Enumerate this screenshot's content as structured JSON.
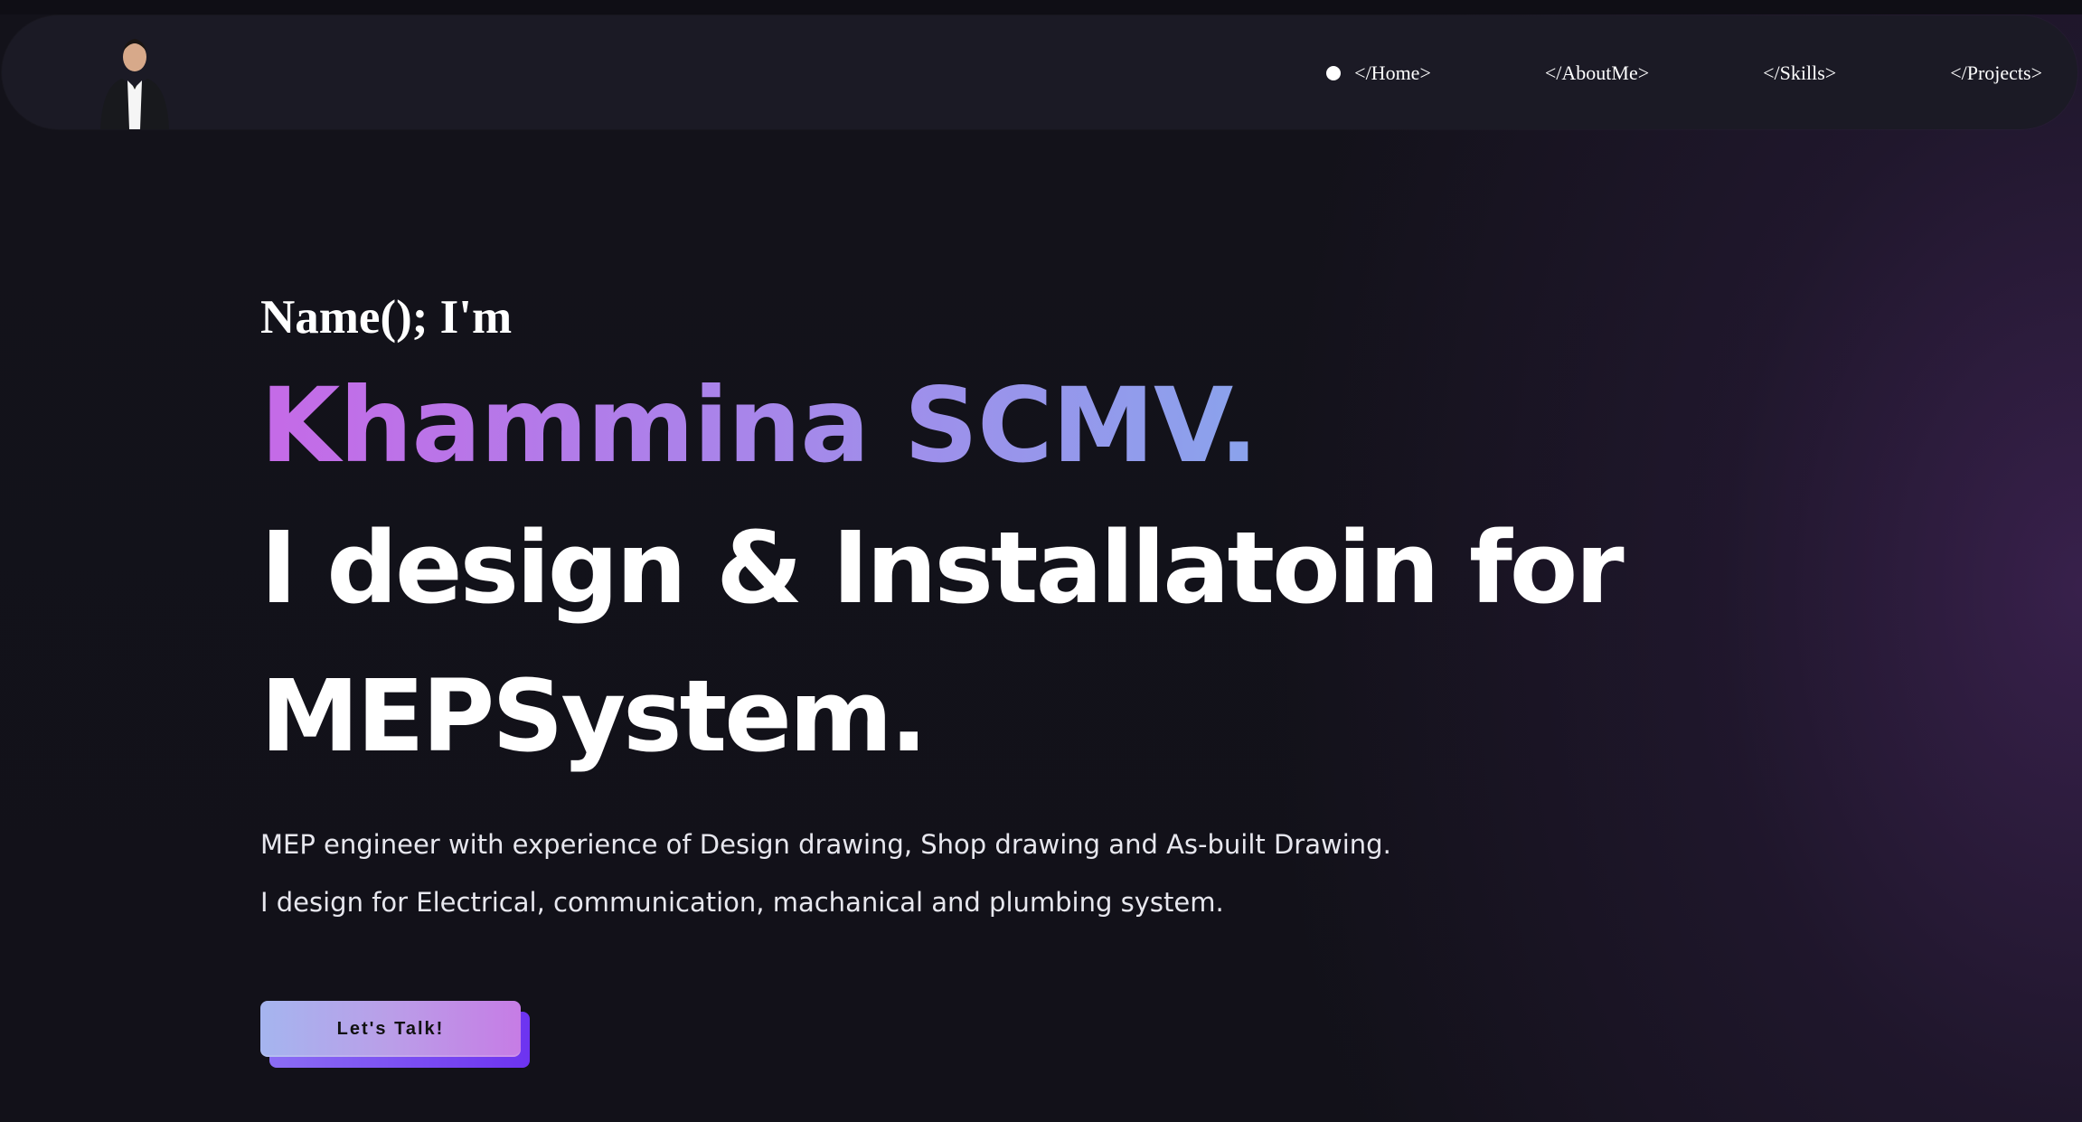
{
  "nav": {
    "avatar_alt": "Khammina profile photo",
    "links": [
      {
        "label": "</Home>",
        "active": true
      },
      {
        "label": "</AboutMe>",
        "active": false
      },
      {
        "label": "</Skills>",
        "active": false
      },
      {
        "label": "</Projects>",
        "active": false
      }
    ]
  },
  "hero": {
    "intro": "Name(); I'm",
    "name": "Khammina SCMV.",
    "headline_line1": "I design & Installatoin for",
    "headline_line2": "MEPSystem.",
    "description_line1": "MEP engineer with experience of Design drawing, Shop drawing and As-built Drawing.",
    "description_line2": "I design for Electrical, communication, machanical and plumbing system.",
    "cta_label": "Let's Talk!"
  },
  "colors": {
    "background": "#13121b",
    "navbar": "#1b1a25",
    "name_gradient_start": "#c56ae7",
    "name_gradient_end": "#8aa3ec",
    "cta_gradient_start": "#a5b5ef",
    "cta_gradient_end": "#c67ce5",
    "cta_shadow": "#6d33f0"
  }
}
